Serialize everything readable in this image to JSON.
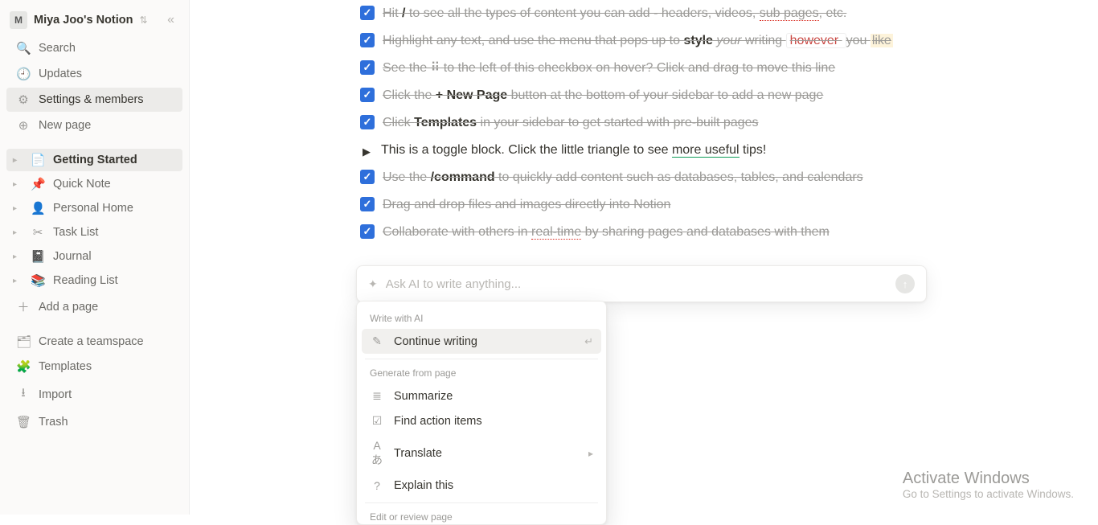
{
  "workspace": {
    "badge": "M",
    "title": "Miya Joo's Notion"
  },
  "sidebar": {
    "search": "Search",
    "updates": "Updates",
    "settings": "Settings & members",
    "new_page": "New page",
    "pages": [
      {
        "label": "Getting Started",
        "selected": true
      },
      {
        "label": "Quick Note"
      },
      {
        "label": "Personal Home"
      },
      {
        "label": "Task List"
      },
      {
        "label": "Journal"
      },
      {
        "label": "Reading List"
      }
    ],
    "add_page": "Add a page",
    "teamspace": "Create a teamspace",
    "templates": "Templates",
    "import": "Import",
    "trash": "Trash"
  },
  "blocks": {
    "0": {
      "prefix": "Hit ",
      "slash": "/",
      "rest": " to see all the types of content you can add - headers, videos, ",
      "sub": "sub pages",
      "tail": ", etc."
    },
    "1": {
      "a": "Highlight any text, and use the menu that pops up to ",
      "style": "style",
      "your": " your ",
      "writing": "writing ",
      "however": " however ",
      "you": " you ",
      "like": "like"
    },
    "2": {
      "a": "See the ",
      "dots": "⠿",
      "b": " to the left of this checkbox on hover? Click and drag to move this line"
    },
    "3": {
      "a": "Click the ",
      "new": "+ New Page",
      "b": " button at the bottom of your sidebar to add a new page"
    },
    "4": {
      "a": "Click ",
      "tpl": "Templates",
      "b": " in your sidebar to get started with pre-built pages"
    },
    "toggle": {
      "a": "This is a toggle block. Click the little triangle to see ",
      "more": "more useful",
      "b": " tips!"
    },
    "5": {
      "a": "Use the ",
      "cmd": "/command",
      "b": " to quickly add content such as databases, tables, and calendars"
    },
    "6": {
      "a": "Drag and drop files and images directly into Notion"
    },
    "7": {
      "a": "Collaborate with others in ",
      "rt": "real-time",
      "b": " by sharing pages and databases with them"
    }
  },
  "ai": {
    "placeholder": "Ask AI to write anything...",
    "section1": "Write with AI",
    "continue": "Continue writing",
    "section2": "Generate from page",
    "summarize": "Summarize",
    "findaction": "Find action items",
    "translate": "Translate",
    "explain": "Explain this",
    "section3": "Edit or review page"
  },
  "activate": {
    "t1": "Activate Windows",
    "t2": "Go to Settings to activate Windows."
  }
}
